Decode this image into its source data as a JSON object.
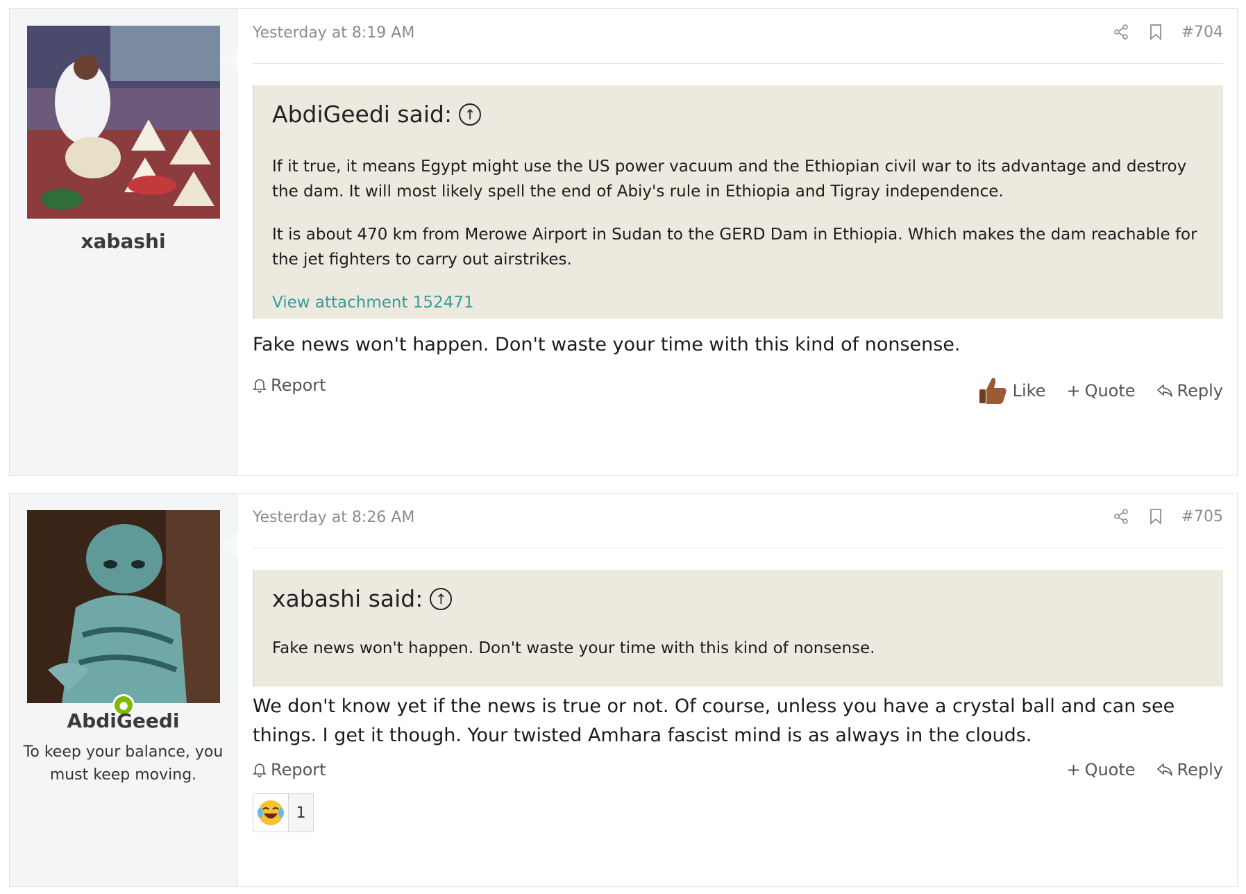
{
  "posts": [
    {
      "username": "xabashi",
      "timestamp": "Yesterday at 8:19 AM",
      "post_number": "#704",
      "quote": {
        "author_said": "AbdiGeedi said:",
        "paragraphs": [
          "If it true, it means Egypt might use the US power vacuum and the Ethiopian civil war to its advantage and destroy the dam. It will most likely spell the end of Abiy's rule in Ethiopia and Tigray independence.",
          "It is about 470 km from Merowe Airport in Sudan to the GERD Dam in Ethiopia. Which makes the dam reachable for the jet fighters to carry out airstrikes."
        ],
        "attachment": "View attachment 152471"
      },
      "body": "Fake news won't happen. Don't waste your time with this kind of nonsense.",
      "actions": {
        "report": "Report",
        "like": "Like",
        "quote": "Quote",
        "reply": "Reply"
      }
    },
    {
      "username": "AbdiGeedi",
      "user_title": "To keep your balance, you must keep moving.",
      "timestamp": "Yesterday at 8:26 AM",
      "post_number": "#705",
      "quote": {
        "author_said": "xabashi said:",
        "paragraphs": [
          "Fake news won't happen. Don't waste your time with this kind of nonsense."
        ]
      },
      "body": "We don't know yet if the news is true or not. Of course, unless you have a crystal ball and can see things. I get it though. Your twisted Amhara fascist mind is as always in the clouds.",
      "actions": {
        "report": "Report",
        "quote": "Quote",
        "reply": "Reply"
      },
      "reaction": {
        "emoji": "laughing-tears",
        "count": "1"
      }
    }
  ],
  "colors": {
    "quote_bg": "#ece9de",
    "link": "#3a9a99",
    "online": "#7fb900"
  }
}
